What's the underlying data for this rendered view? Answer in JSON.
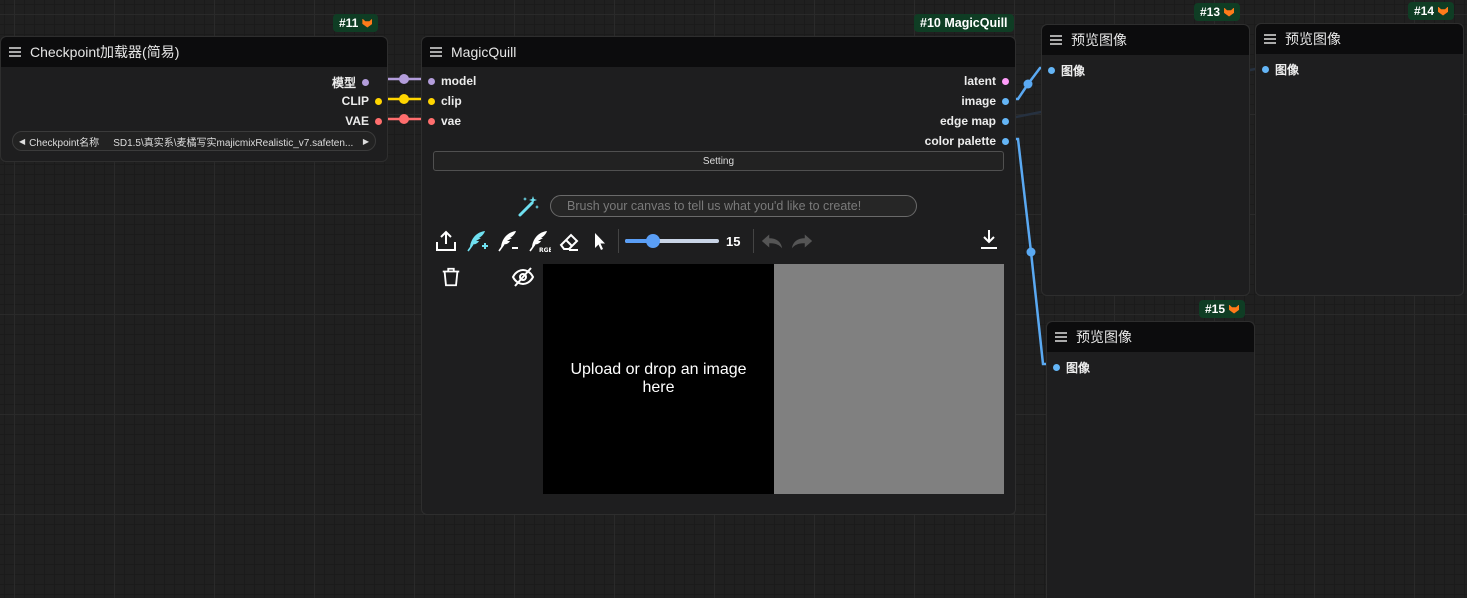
{
  "nodes": {
    "checkpoint": {
      "badge": "#11",
      "title": "Checkpoint加载器(简易)",
      "outputs": [
        "模型",
        "CLIP",
        "VAE"
      ],
      "widget": {
        "label": "Checkpoint名称",
        "value": "SD1.5\\真实系\\麦橘写实majicmixRealistic_v7.safeten..."
      }
    },
    "magicquill": {
      "badge": "#10 MagicQuill",
      "title": "MagicQuill",
      "inputs": [
        "model",
        "clip",
        "vae"
      ],
      "outputs": [
        "latent",
        "image",
        "edge map",
        "color palette"
      ],
      "setting_label": "Setting",
      "prompt_placeholder": "Brush your canvas to tell us what you'd like to create!",
      "brush_size": "15",
      "brush_size_fraction": 0.3,
      "canvas_text": "Upload or drop an image here"
    },
    "preview13": {
      "badge": "#13",
      "title": "预览图像",
      "input": "图像"
    },
    "preview14": {
      "badge": "#14",
      "title": "预览图像",
      "input": "图像"
    },
    "preview15": {
      "badge": "#15",
      "title": "预览图像",
      "input": "图像"
    }
  },
  "colors": {
    "model": "#b39ddb",
    "clip": "#ffd500",
    "vae": "#ff6e6e",
    "latent": "#ff9cf9",
    "image": "#64b5f6",
    "wire_image": "#5aa9f2",
    "wire_dim": "#263140",
    "badge_bg": "#0f3d24",
    "accent_icon": "#6fe0f0"
  },
  "icons": [
    "menu-icon",
    "fox-icon",
    "magic-wand-icon",
    "upload-icon",
    "brush-add-icon",
    "brush-subtract-icon",
    "brush-rgb-icon",
    "eraser-icon",
    "pointer-icon",
    "undo-icon",
    "redo-icon",
    "download-icon",
    "trash-icon",
    "eye-off-icon"
  ]
}
